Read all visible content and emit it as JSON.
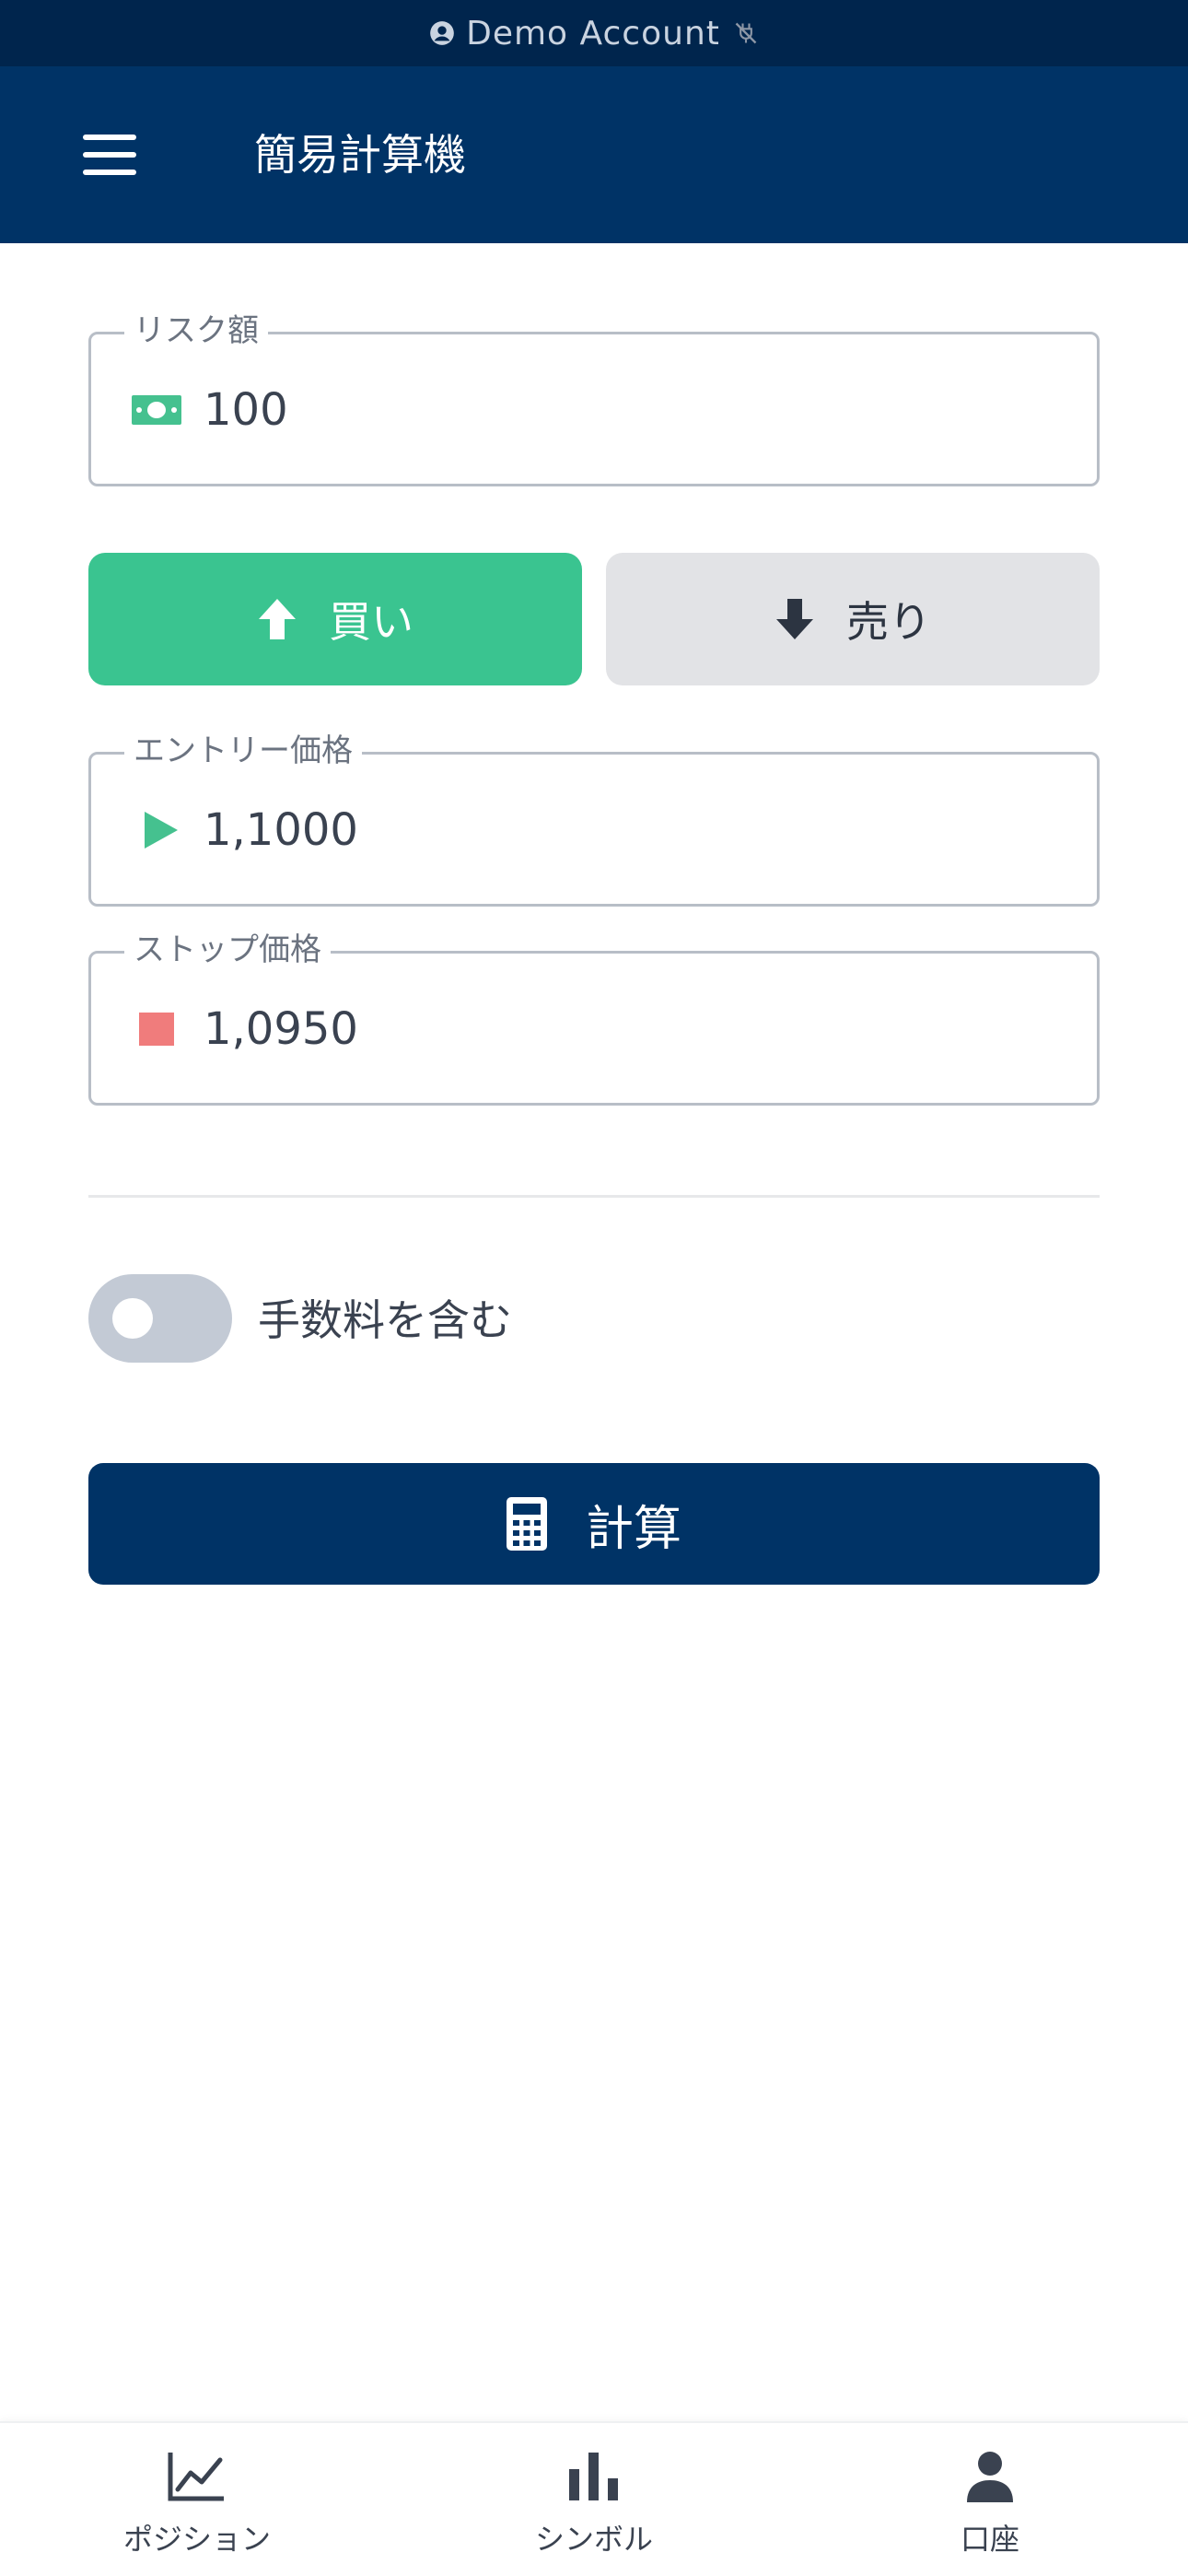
{
  "demo_bar": {
    "text": "Demo Account"
  },
  "header": {
    "title": "簡易計算機"
  },
  "risk_field": {
    "label": "リスク額",
    "value": "100",
    "icon": "money-icon"
  },
  "direction": {
    "buy_label": "買い",
    "sell_label": "売り",
    "selected": "buy"
  },
  "entry_field": {
    "label": "エントリー価格",
    "value": "1,1000",
    "icon": "play-icon"
  },
  "stop_field": {
    "label": "ストップ価格",
    "value": "1,0950",
    "icon": "stop-square-icon"
  },
  "fees_toggle": {
    "label": "手数料を含む",
    "checked": false
  },
  "calculate": {
    "label": "計算",
    "icon": "calculator-icon"
  },
  "bottom_nav": {
    "items": [
      {
        "label": "ポジション",
        "icon": "line-chart-icon"
      },
      {
        "label": "シンボル",
        "icon": "bar-chart-icon"
      },
      {
        "label": "口座",
        "icon": "user-icon"
      }
    ]
  },
  "colors": {
    "primary": "#003366",
    "demo_bar": "#00254d",
    "buy": "#3ac490",
    "sell_bg": "#e2e3e6",
    "stop": "#f07c7c",
    "toggle_off": "#c3cad5"
  }
}
